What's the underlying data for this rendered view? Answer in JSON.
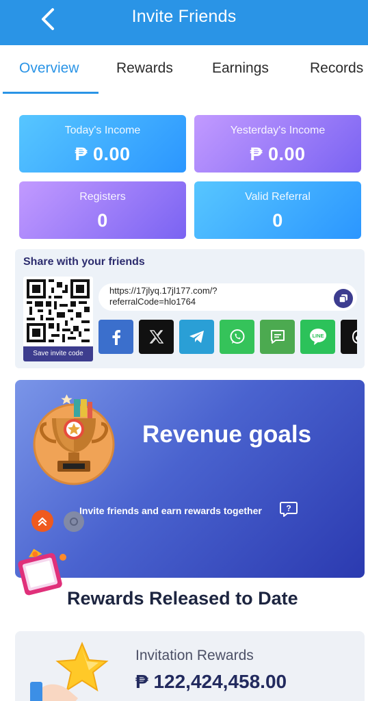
{
  "header": {
    "title": "Invite Friends"
  },
  "tabs": [
    {
      "label": "Overview"
    },
    {
      "label": "Rewards"
    },
    {
      "label": "Earnings"
    },
    {
      "label": "Records"
    }
  ],
  "stats": {
    "today_income": {
      "label": "Today's Income",
      "value": "₱ 0.00"
    },
    "yesterday_income": {
      "label": "Yesterday's Income",
      "value": "₱ 0.00"
    },
    "registers": {
      "label": "Registers",
      "value": "0"
    },
    "valid_referral": {
      "label": "Valid Referral",
      "value": "0"
    }
  },
  "share": {
    "title": "Share with your friends",
    "save_label": "Save invite code",
    "link_line1": "https://17jlyq.17jl177.com/?",
    "link_line2": "referralCode=hlo1764",
    "socials": [
      "facebook-icon",
      "x-icon",
      "telegram-icon",
      "whatsapp-icon",
      "sms-icon",
      "line-icon",
      "threads-icon"
    ],
    "line_label": "LINE"
  },
  "goals": {
    "title": "Revenue goals",
    "subtitle": "Invite friends and earn rewards together"
  },
  "released": {
    "title": "Rewards Released to Date",
    "label": "Invitation Rewards",
    "value": "₱ 122,424,458.00"
  },
  "colors": {
    "primary": "#2a94e6",
    "dark_purple": "#3c3c8f",
    "facebook": "#3b6fcc",
    "telegram": "#2a9fd6",
    "whatsapp": "#35c35a",
    "sms": "#4caa50",
    "line": "#2cc25a"
  }
}
